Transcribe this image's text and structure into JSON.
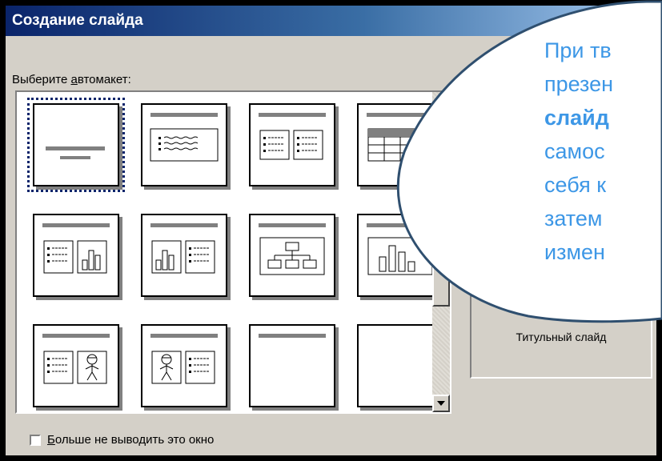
{
  "window": {
    "title": "Создание слайда"
  },
  "prompt": {
    "before": "Выберите ",
    "underlined": "а",
    "after": "втомакет:"
  },
  "layouts": [
    "title-slide",
    "bulleted-list",
    "two-column-text",
    "table",
    "text-and-chart",
    "chart-and-text",
    "organization-chart",
    "chart",
    "text-and-clip-art",
    "clip-art-and-text",
    "title-only",
    "blank"
  ],
  "preview": {
    "label": "Титульный слайд"
  },
  "checkbox": {
    "underlined": "Б",
    "after": "ольше не выводить это окно",
    "checked": false
  },
  "callout": {
    "lines": [
      "При тв",
      "презен",
      "слайд",
      "самос",
      "себя к",
      "затем",
      "измен"
    ],
    "bold_line_index": 2,
    "color": "#3d97e6"
  }
}
